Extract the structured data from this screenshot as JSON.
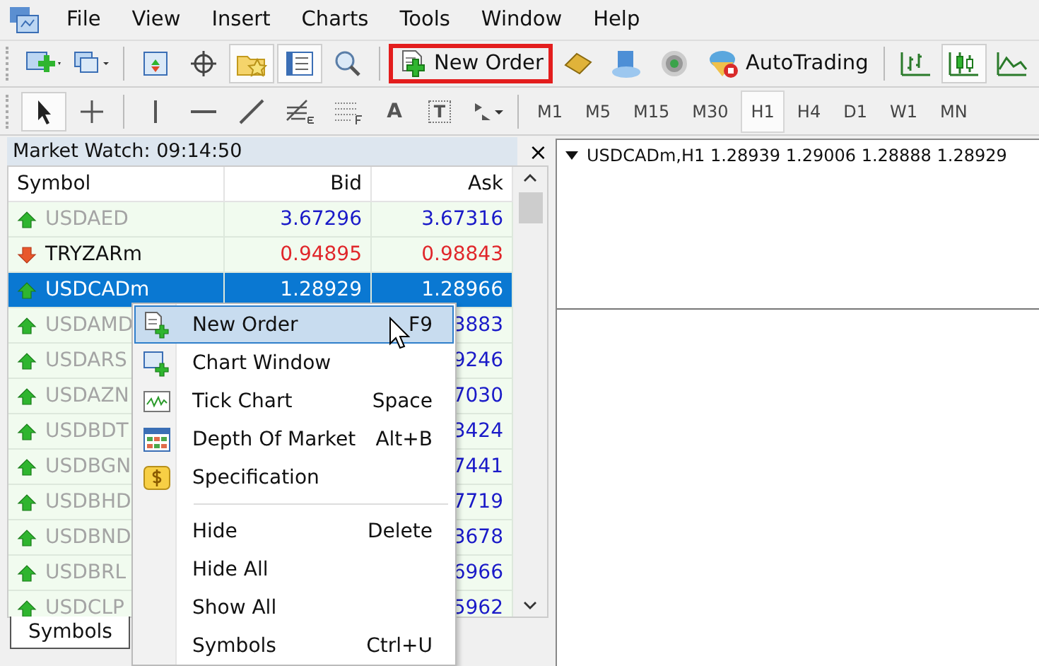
{
  "menu_bar": [
    "File",
    "View",
    "Insert",
    "Charts",
    "Tools",
    "Window",
    "Help"
  ],
  "toolbar": [
    {
      "kind": "new-chart",
      "pressed": false
    },
    {
      "kind": "profiles",
      "pressed": false
    },
    {
      "kind": "sep"
    },
    {
      "kind": "market-watch",
      "pressed": false
    },
    {
      "kind": "crosshair",
      "pressed": false
    },
    {
      "kind": "navigator",
      "pressed": true
    },
    {
      "kind": "data-window",
      "pressed": true
    },
    {
      "kind": "tester",
      "pressed": false
    },
    {
      "kind": "sep"
    },
    {
      "kind": "order",
      "label": "New Order",
      "highlighted": true
    },
    {
      "kind": "editor",
      "pressed": false
    },
    {
      "kind": "cloud",
      "pressed": false
    },
    {
      "kind": "signals",
      "pressed": false
    },
    {
      "kind": "auto",
      "label": "AutoTrading",
      "highlighted": false
    },
    {
      "kind": "sep"
    },
    {
      "kind": "bar-chart",
      "pressed": false
    },
    {
      "kind": "candle-chart",
      "pressed": true
    },
    {
      "kind": "line-chart",
      "pressed": false
    }
  ],
  "tools": [
    {
      "kind": "cursor",
      "pressed": true
    },
    {
      "kind": "crosshair",
      "pressed": false
    },
    {
      "kind": "sep"
    },
    {
      "kind": "vline",
      "pressed": false
    },
    {
      "kind": "hline",
      "pressed": false
    },
    {
      "kind": "trend",
      "pressed": false
    },
    {
      "kind": "fibo",
      "pressed": false
    },
    {
      "kind": "grid",
      "pressed": false
    },
    {
      "kind": "glyph",
      "label": "A",
      "pressed": false
    },
    {
      "kind": "label",
      "label": "T",
      "pressed": false
    },
    {
      "kind": "shapes",
      "pressed": false
    }
  ],
  "timeframes": [
    {
      "label": "M1",
      "selected": false
    },
    {
      "label": "M5",
      "selected": false
    },
    {
      "label": "M15",
      "selected": false
    },
    {
      "label": "M30",
      "selected": false
    },
    {
      "label": "H1",
      "selected": true
    },
    {
      "label": "H4",
      "selected": false
    },
    {
      "label": "D1",
      "selected": false
    },
    {
      "label": "W1",
      "selected": false
    },
    {
      "label": "MN",
      "selected": false
    }
  ],
  "market_watch": {
    "title": "Market Watch: 09:14:50",
    "close": "×",
    "columns": [
      "Symbol",
      "Bid",
      "Ask"
    ],
    "rows": [
      {
        "symbol": "USDAED",
        "bid": "3.67296",
        "ask": "3.67316",
        "rising": true,
        "dimmed": true,
        "selected": false
      },
      {
        "symbol": "TRYZARm",
        "bid": "0.94895",
        "ask": "0.98843",
        "rising": false,
        "dimmed": false,
        "selected": false
      },
      {
        "symbol": "USDCADm",
        "bid": "1.28929",
        "ask": "1.28966",
        "rising": true,
        "dimmed": false,
        "selected": true
      },
      {
        "symbol": "USDAMD",
        "ask": "3883",
        "rising": true,
        "dimmed": true,
        "selected": false
      },
      {
        "symbol": "USDARS",
        "ask": "9246",
        "rising": true,
        "dimmed": true,
        "selected": false
      },
      {
        "symbol": "USDAZN",
        "ask": "7030",
        "rising": true,
        "dimmed": true,
        "selected": false
      },
      {
        "symbol": "USDBDT",
        "ask": "3424",
        "rising": true,
        "dimmed": true,
        "selected": false
      },
      {
        "symbol": "USDBGN",
        "ask": "7441",
        "rising": true,
        "dimmed": true,
        "selected": false
      },
      {
        "symbol": "USDBHD",
        "ask": "7719",
        "rising": true,
        "dimmed": true,
        "selected": false
      },
      {
        "symbol": "USDBND",
        "ask": "3678",
        "rising": true,
        "dimmed": true,
        "selected": false
      },
      {
        "symbol": "USDBRL",
        "ask": "6966",
        "rising": true,
        "dimmed": true,
        "selected": false
      },
      {
        "symbol": "USDCLP",
        "ask": "5962",
        "rising": true,
        "dimmed": true,
        "selected": false
      }
    ],
    "tabs": [
      {
        "label": "Symbols",
        "selected": true
      }
    ]
  },
  "chart": {
    "title": "USDCADm,H1  1.28939 1.29006 1.28888 1.28929"
  },
  "context_menu": [
    {
      "kind": "item",
      "label": "New Order",
      "shortcut": "F9",
      "selected": true
    },
    {
      "kind": "item",
      "label": "Chart Window",
      "selected": false
    },
    {
      "kind": "item",
      "label": "Tick Chart",
      "shortcut": "Space",
      "selected": false
    },
    {
      "kind": "item",
      "label": "Depth Of Market",
      "shortcut": "Alt+B",
      "selected": false
    },
    {
      "kind": "item",
      "label": "Specification",
      "selected": false
    },
    {
      "kind": "separator"
    },
    {
      "kind": "item",
      "label": "Hide",
      "shortcut": "Delete",
      "selected": false
    },
    {
      "kind": "item",
      "label": "Hide All",
      "selected": false
    },
    {
      "kind": "item",
      "label": "Show All",
      "selected": false
    },
    {
      "kind": "item",
      "label": "Symbols",
      "shortcut": "Ctrl+U",
      "selected": false
    }
  ]
}
